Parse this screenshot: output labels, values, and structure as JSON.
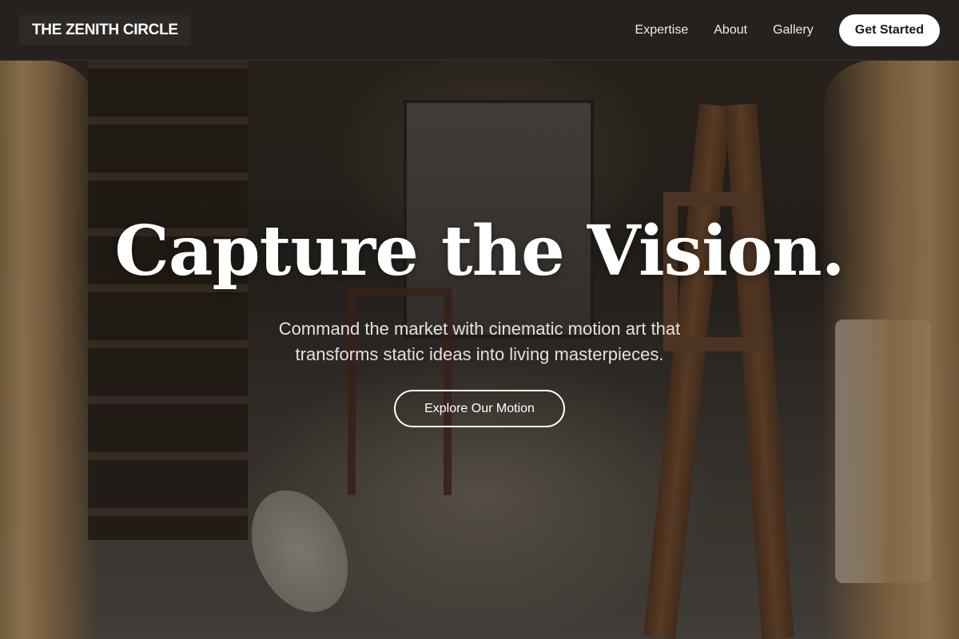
{
  "navbar": {
    "brand": "THE ZENITH CIRCLE",
    "links": [
      "Expertise",
      "About",
      "Gallery"
    ],
    "cta_label": "Get Started"
  },
  "hero": {
    "title": "Capture the Vision.",
    "subtitle": "Command the market with cinematic motion art that transforms static ideas into living masterpieces.",
    "button_label": "Explore Our Motion"
  },
  "colors": {
    "navbar_bg": "#24211f",
    "cta_bg": "#ffffff",
    "cta_text": "#1d1b19",
    "text_primary": "#ffffff",
    "text_secondary": "#e4e1dc"
  }
}
